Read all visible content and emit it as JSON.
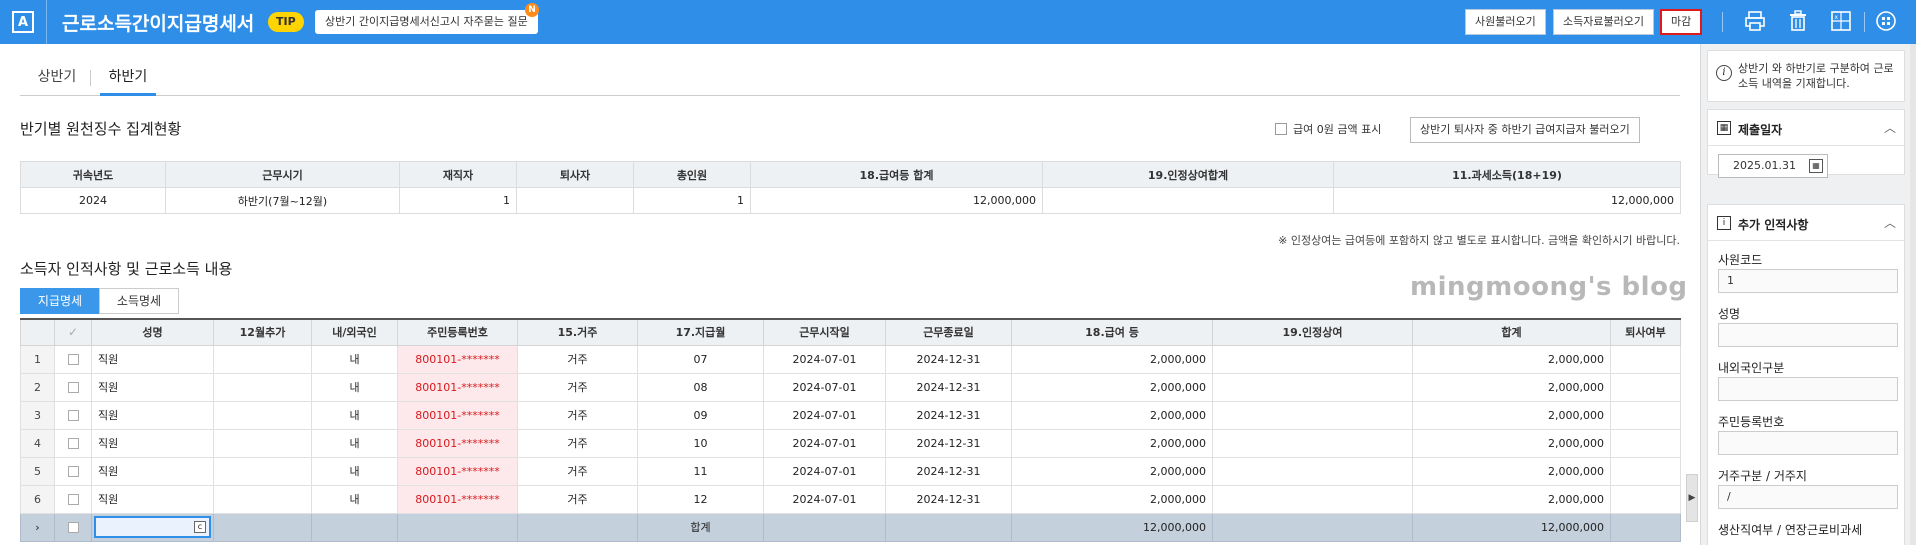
{
  "header": {
    "logo": "A",
    "title": "근로소득간이지급명세서",
    "tip_badge": "TIP",
    "tip_text": "상반기 간이지급명세서신고시 자주묻는 질문",
    "tip_new": "N",
    "buttons": {
      "load_employees": "사원불러오기",
      "load_income": "소득자료불러오기",
      "close": "마감"
    },
    "icons": [
      "print-icon",
      "trash-icon",
      "excel-icon",
      "grid-menu-icon"
    ]
  },
  "tabs": [
    {
      "label": "상반기",
      "active": false
    },
    {
      "label": "하반기",
      "active": true
    }
  ],
  "summary": {
    "title": "반기별 원천징수 집계현황",
    "zero_amount_label": "급여 0원 금액 표시",
    "load_button": "상반기 퇴사자 중 하반기 급여지급자 불러오기",
    "columns": [
      "귀속년도",
      "근무시기",
      "재직자",
      "퇴사자",
      "총인원",
      "18.급여등 합계",
      "19.인정상여합계",
      "11.과세소득(18+19)"
    ],
    "row": {
      "year": "2024",
      "period": "하반기(7월~12월)",
      "employed": "1",
      "retired": "",
      "total": "1",
      "salary_total": "12,000,000",
      "bonus_total": "",
      "taxable": "12,000,000"
    },
    "note": "※ 인정상여는 급여등에 포함하지 않고 별도로 표시합니다. 금액을 확인하시기 바랍니다."
  },
  "detail": {
    "title": "소득자 인적사항 및 근로소득 내용",
    "subtabs": [
      {
        "label": "지급명세",
        "active": true
      },
      {
        "label": "소득명세",
        "active": false
      }
    ],
    "watermark": "mingmoong's blog",
    "columns": [
      "성명",
      "12월추가",
      "내/외국인",
      "주민등록번호",
      "15.거주",
      "17.지급월",
      "근무시작일",
      "근무종료일",
      "18.급여 등",
      "19.인정상여",
      "합계",
      "퇴사여부"
    ],
    "rows": [
      {
        "no": "1",
        "name": "직원",
        "dec": "",
        "nation": "내",
        "rrn": "800101-*******",
        "residence": "거주",
        "month": "07",
        "start": "2024-07-01",
        "end": "2024-12-31",
        "salary": "2,000,000",
        "bonus": "",
        "total": "2,000,000",
        "retired": ""
      },
      {
        "no": "2",
        "name": "직원",
        "dec": "",
        "nation": "내",
        "rrn": "800101-*******",
        "residence": "거주",
        "month": "08",
        "start": "2024-07-01",
        "end": "2024-12-31",
        "salary": "2,000,000",
        "bonus": "",
        "total": "2,000,000",
        "retired": ""
      },
      {
        "no": "3",
        "name": "직원",
        "dec": "",
        "nation": "내",
        "rrn": "800101-*******",
        "residence": "거주",
        "month": "09",
        "start": "2024-07-01",
        "end": "2024-12-31",
        "salary": "2,000,000",
        "bonus": "",
        "total": "2,000,000",
        "retired": ""
      },
      {
        "no": "4",
        "name": "직원",
        "dec": "",
        "nation": "내",
        "rrn": "800101-*******",
        "residence": "거주",
        "month": "10",
        "start": "2024-07-01",
        "end": "2024-12-31",
        "salary": "2,000,000",
        "bonus": "",
        "total": "2,000,000",
        "retired": ""
      },
      {
        "no": "5",
        "name": "직원",
        "dec": "",
        "nation": "내",
        "rrn": "800101-*******",
        "residence": "거주",
        "month": "11",
        "start": "2024-07-01",
        "end": "2024-12-31",
        "salary": "2,000,000",
        "bonus": "",
        "total": "2,000,000",
        "retired": ""
      },
      {
        "no": "6",
        "name": "직원",
        "dec": "",
        "nation": "내",
        "rrn": "800101-*******",
        "residence": "거주",
        "month": "12",
        "start": "2024-07-01",
        "end": "2024-12-31",
        "salary": "2,000,000",
        "bonus": "",
        "total": "2,000,000",
        "retired": ""
      }
    ],
    "total_row": {
      "marker": "›",
      "label": "합계",
      "salary": "12,000,000",
      "total": "12,000,000"
    }
  },
  "panel": {
    "info_text": "상반기 와 하반기로 구분하여 근로소득 내역을 기재합니다.",
    "submit_date_title": "제출일자",
    "submit_date": "2025.01.31",
    "extra_title": "추가 인적사항",
    "fields": [
      {
        "label": "사원코드",
        "value": "1"
      },
      {
        "label": "성명",
        "value": ""
      },
      {
        "label": "내외국인구분",
        "value": ""
      },
      {
        "label": "주민등록번호",
        "value": ""
      },
      {
        "label": "거주구분 / 거주지",
        "value": "/"
      },
      {
        "label": "생산직여부 / 연장근로비과세",
        "value": ""
      }
    ]
  },
  "colors": {
    "header_bg": "#2f8fe8",
    "close_border": "#e01919",
    "rrn_text": "#d8191b",
    "rrn_bg": "#fde9ec",
    "total_row_bg": "#c4d0dc"
  }
}
